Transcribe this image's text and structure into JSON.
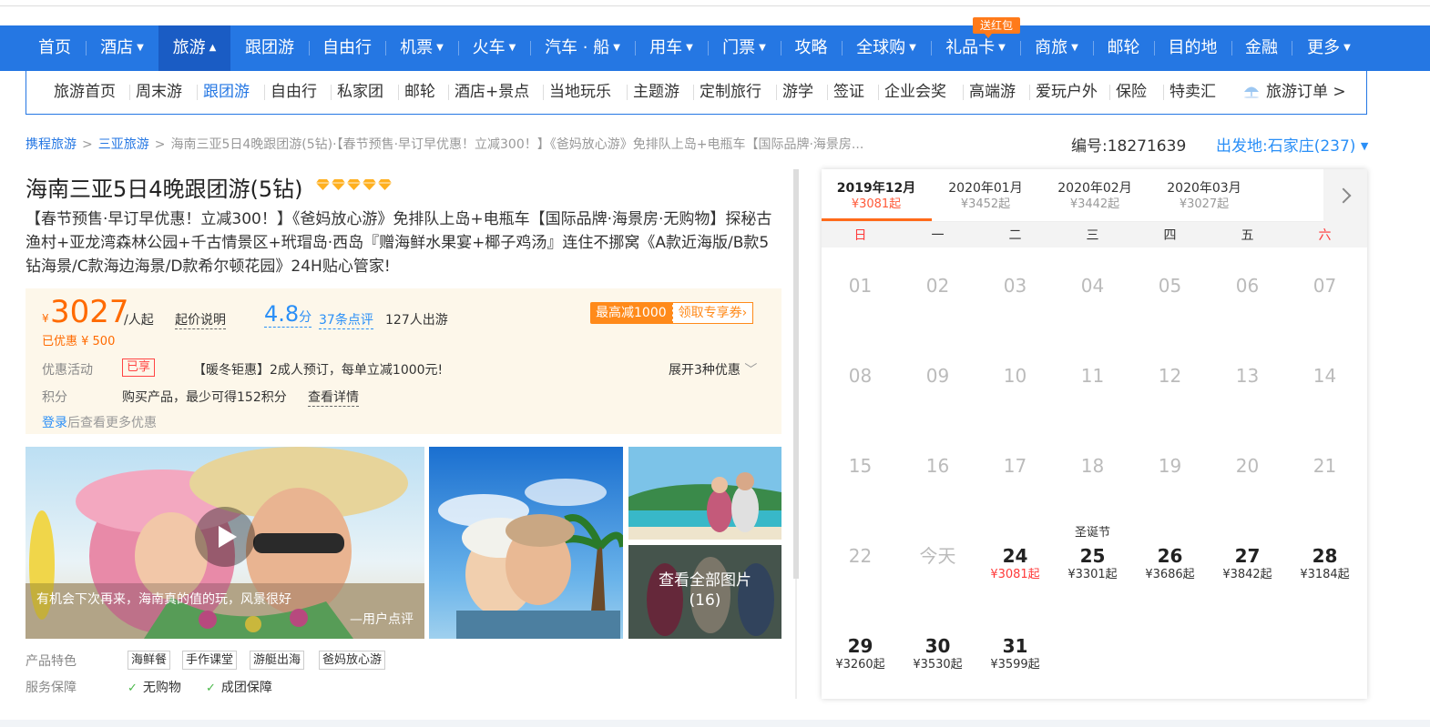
{
  "main_nav": [
    {
      "label": "首页",
      "dropdown": false
    },
    {
      "label": "酒店",
      "dropdown": true
    },
    {
      "label": "旅游",
      "dropdown": true,
      "active": true
    },
    {
      "label": "跟团游",
      "dropdown": false
    },
    {
      "label": "自由行",
      "dropdown": false
    },
    {
      "label": "机票",
      "dropdown": true
    },
    {
      "label": "火车",
      "dropdown": true
    },
    {
      "label": "汽车 · 船",
      "dropdown": true
    },
    {
      "label": "用车",
      "dropdown": true
    },
    {
      "label": "门票",
      "dropdown": true
    },
    {
      "label": "攻略",
      "dropdown": false
    },
    {
      "label": "全球购",
      "dropdown": true
    },
    {
      "label": "礼品卡",
      "dropdown": true
    },
    {
      "label": "商旅",
      "dropdown": true
    },
    {
      "label": "邮轮",
      "dropdown": false
    },
    {
      "label": "目的地",
      "dropdown": false
    },
    {
      "label": "金融",
      "dropdown": false
    },
    {
      "label": "更多",
      "dropdown": true
    }
  ],
  "hongbao_badge": "送红包",
  "sub_nav": [
    "旅游首页",
    "周末游",
    "跟团游",
    "自由行",
    "私家团",
    "邮轮",
    "酒店+景点",
    "当地玩乐",
    "主题游",
    "定制旅行",
    "游学",
    "签证",
    "企业会奖",
    "高端游",
    "爱玩户外",
    "保险",
    "特卖汇"
  ],
  "travel_order": "旅游订单 >",
  "breadcrumb": {
    "items": [
      "携程旅游",
      "三亚旅游"
    ],
    "current": "海南三亚5日4晚跟团游(5钻)·【春节预售·早订早优惠！立减300！】《爸妈放心游》免排队上岛+电瓶车【国际品牌·海景房..."
  },
  "product_no": "编号:18271639",
  "departure": "出发地:石家庄(237)",
  "title": "海南三亚5日4晚跟团游(5钻)",
  "description": "【春节预售·早订早优惠！立减300！】《爸妈放心游》免排队上岛+电瓶车【国际品牌·海景房·无购物】探秘古渔村+亚龙湾森林公园+千古情景区+玳瑁岛·西岛『赠海鲜水果宴+椰子鸡汤』连住不挪窝《A款近海版/B款5钻海景/C款海边海景/D款希尔顿花园》24H贴心管家!",
  "price": {
    "currency": "¥",
    "amount": "3027",
    "unit": "/人起",
    "note": "起价说明",
    "rating": "4.8",
    "rating_unit": "分",
    "reviews": "37条点评",
    "travelers": "127人出游",
    "discount": "已优惠 ¥ 500",
    "coupon_left": "最高减1000",
    "coupon_right": "领取专享券›"
  },
  "promo": {
    "label": "优惠活动",
    "badge": "已享",
    "text": "【暖冬钜惠】2成人预订，每单立减1000元!",
    "expand": "展开3种优惠"
  },
  "points": {
    "label": "积分",
    "text": "购买产品，最少可得152积分",
    "link": "查看详情"
  },
  "login": {
    "link": "登录",
    "text": "后查看更多优惠"
  },
  "gallery": {
    "caption": "有机会下次再来，海南真的值的玩，风景很好",
    "caption_by": "—用户点评",
    "all_pics": "查看全部图片",
    "all_count": "(16)"
  },
  "features": {
    "label": "产品特色",
    "tags": [
      "海鲜餐",
      "手作课堂",
      "游艇出海",
      "爸妈放心游"
    ]
  },
  "guarantee": {
    "label": "服务保障",
    "items": [
      "无购物",
      "成团保障"
    ]
  },
  "calendar": {
    "months": [
      {
        "month": "2019年12月",
        "price": "¥3081起",
        "active": true
      },
      {
        "month": "2020年01月",
        "price": "¥3452起"
      },
      {
        "month": "2020年02月",
        "price": "¥3442起"
      },
      {
        "month": "2020年03月",
        "price": "¥3027起"
      }
    ],
    "weekdays": [
      "日",
      "一",
      "二",
      "三",
      "四",
      "五",
      "六"
    ],
    "weeks": [
      [
        {
          "d": "01"
        },
        {
          "d": "02"
        },
        {
          "d": "03"
        },
        {
          "d": "04"
        },
        {
          "d": "05"
        },
        {
          "d": "06"
        },
        {
          "d": "07"
        }
      ],
      [
        {
          "d": "08"
        },
        {
          "d": "09"
        },
        {
          "d": "10"
        },
        {
          "d": "11"
        },
        {
          "d": "12"
        },
        {
          "d": "13"
        },
        {
          "d": "14"
        }
      ],
      [
        {
          "d": "15"
        },
        {
          "d": "16"
        },
        {
          "d": "17"
        },
        {
          "d": "18"
        },
        {
          "d": "19"
        },
        {
          "d": "20"
        },
        {
          "d": "21"
        }
      ],
      [
        {
          "d": "22"
        },
        {
          "d": "今天"
        },
        {
          "d": "24",
          "price": "¥3081起",
          "red": true
        },
        {
          "d": "25",
          "price": "¥3301起",
          "fest": "圣诞节"
        },
        {
          "d": "26",
          "price": "¥3686起"
        },
        {
          "d": "27",
          "price": "¥3842起"
        },
        {
          "d": "28",
          "price": "¥3184起"
        }
      ],
      [
        {
          "d": "29",
          "price": "¥3260起"
        },
        {
          "d": "30",
          "price": "¥3530起"
        },
        {
          "d": "31",
          "price": "¥3599起"
        }
      ]
    ]
  },
  "colors": {
    "brand_blue": "#2577e3",
    "price_orange": "#ff6a00",
    "link_blue": "#2a8ff7"
  }
}
